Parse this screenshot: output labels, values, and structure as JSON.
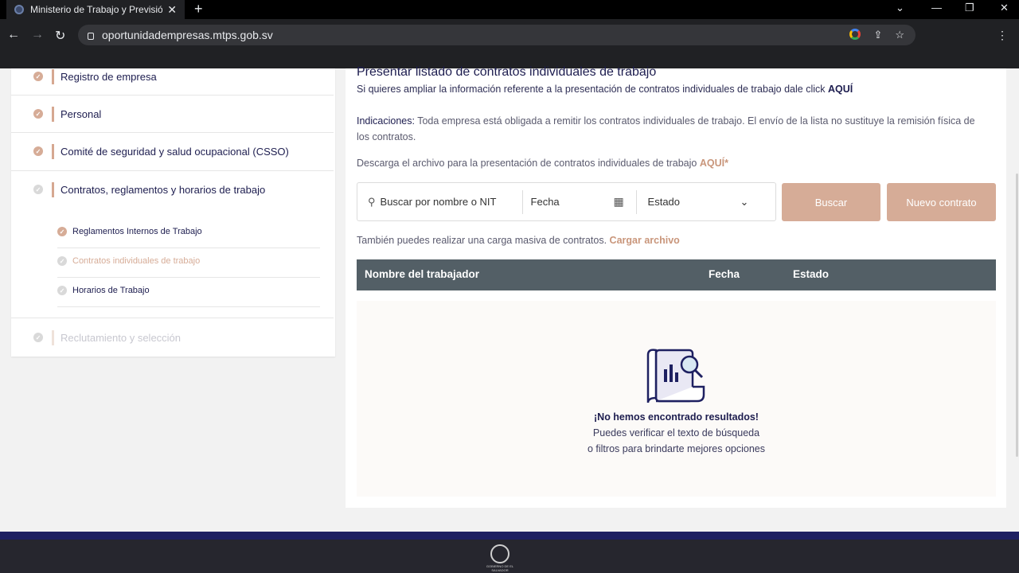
{
  "browser": {
    "tab_title": "Ministerio de Trabajo y Previsión",
    "url": "oportunidadempresas.mtps.gob.sv"
  },
  "sidebar": {
    "items": [
      {
        "label": "Registro de empresa",
        "status": "done"
      },
      {
        "label": "Personal",
        "status": "done"
      },
      {
        "label": "Comité de seguridad y salud ocupacional (CSSO)",
        "status": "done"
      },
      {
        "label": "Contratos, reglamentos y horarios de trabajo",
        "status": "pending"
      },
      {
        "label": "Reclutamiento y selección",
        "status": "disabled"
      }
    ],
    "subitems": [
      {
        "label": "Reglamentos Internos de Trabajo",
        "status": "done"
      },
      {
        "label": "Contratos individuales de trabajo",
        "status": "active"
      },
      {
        "label": "Horarios de Trabajo",
        "status": "pending"
      }
    ]
  },
  "main": {
    "title": "Presentar listado de contratos individuales de trabajo",
    "info_text": "Si quieres ampliar la información referente a la presentación de contratos individuales de trabajo dale click",
    "info_link": "AQUÍ",
    "indications_label": "Indicaciones:",
    "indications_text": "Toda empresa está obligada a remitir los contratos individuales de trabajo. El envío de la lista no sustituye la remisión física de los contratos.",
    "download_text": "Descarga el archivo para la presentación de contratos individuales de trabajo",
    "download_link": "AQUÍ*",
    "search_placeholder": "Buscar por nombre o NIT",
    "date_placeholder": "Fecha",
    "status_select": "Estado",
    "search_button": "Buscar",
    "new_button": "Nuevo contrato",
    "bulk_text": "También puedes realizar una carga masiva de contratos.",
    "bulk_link": "Cargar archivo",
    "table_headers": [
      "Nombre del trabajador",
      "Fecha",
      "Estado"
    ],
    "empty_title": "¡No hemos encontrado resultados!",
    "empty_line1": "Puedes verificar el texto de búsqueda",
    "empty_line2": "o filtros para brindarte mejores opciones"
  },
  "footer": {
    "seal_text": "GOBIERNO DE EL SALVADOR"
  },
  "colors": {
    "accent": "#d6ac97",
    "navy": "#1d1d4f",
    "table_header": "#535f66",
    "footer_band": "#1e2061"
  }
}
